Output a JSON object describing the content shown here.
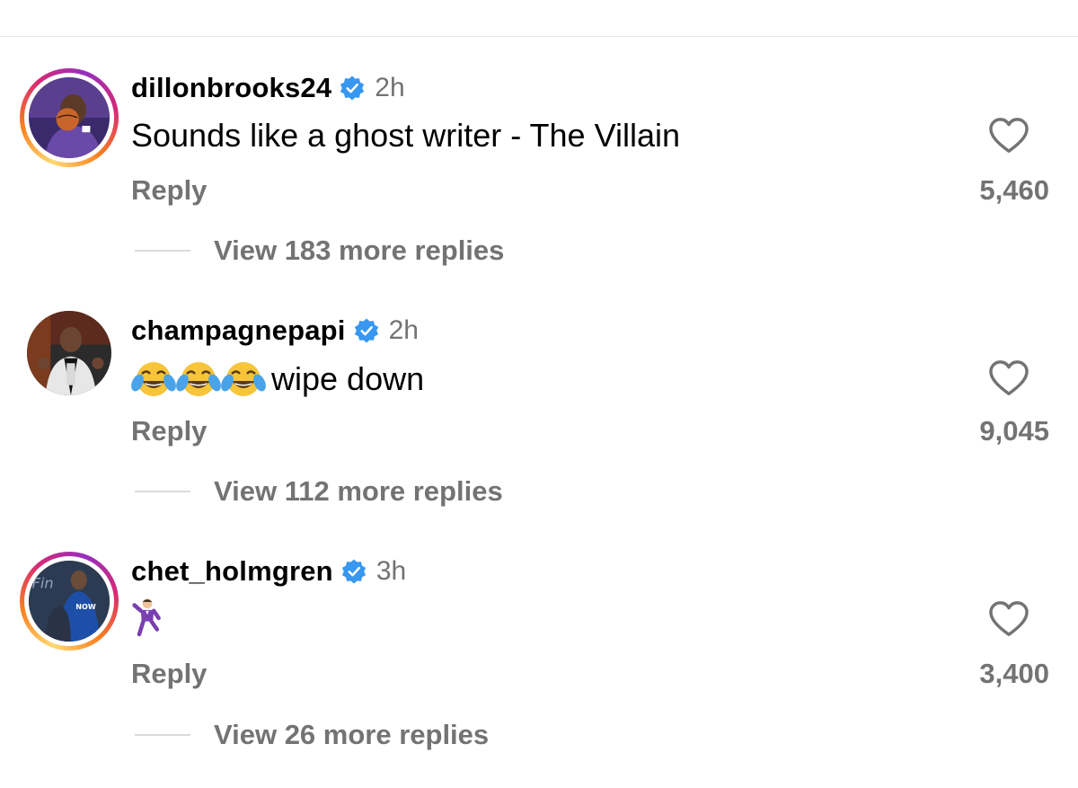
{
  "comments": [
    {
      "username": "dillonbrooks24",
      "time": "2h",
      "text": "Sounds like a ghost writer - The Villain",
      "emojis": [],
      "reply_label": "Reply",
      "likes": "5,460",
      "view_replies": "View 183 more replies",
      "story_ring": true
    },
    {
      "username": "champagnepapi",
      "time": "2h",
      "text": "wipe down",
      "emojis": [
        "face-with-tears-of-joy",
        "face-with-tears-of-joy",
        "face-with-tears-of-joy"
      ],
      "reply_label": "Reply",
      "likes": "9,045",
      "view_replies": "View 112 more replies",
      "story_ring": false
    },
    {
      "username": "chet_holmgren",
      "time": "3h",
      "text": "",
      "emojis": [
        "man-dancing"
      ],
      "reply_label": "Reply",
      "likes": "3,400",
      "view_replies": "View 26 more replies",
      "story_ring": true
    }
  ],
  "colors": {
    "verified": "#3897f0",
    "secondary_text": "#737373",
    "divider": "#dbdbdb"
  },
  "icons": {
    "like": "heart-outline-icon",
    "verified": "verified-badge-icon"
  }
}
